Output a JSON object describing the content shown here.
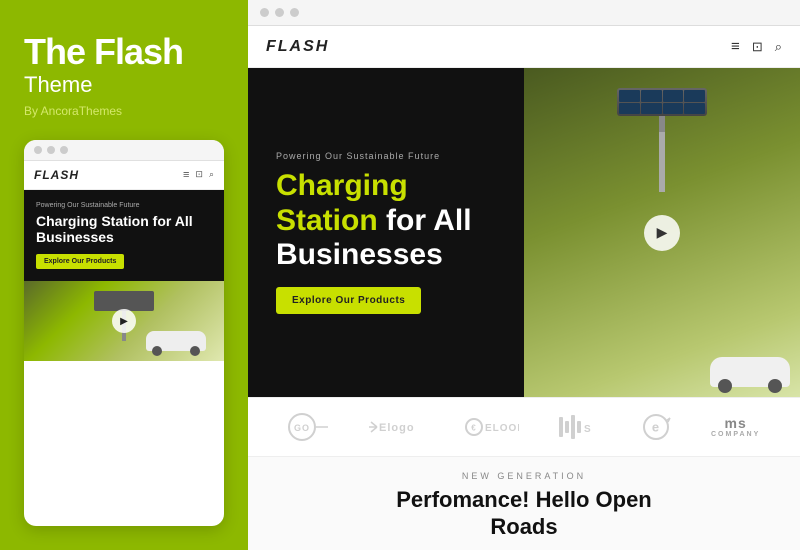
{
  "sidebar": {
    "title": "The Flash",
    "subtitle": "Theme",
    "byline": "By AncoraThemes",
    "mobile_dots": [
      "dot1",
      "dot2",
      "dot3"
    ],
    "mobile_logo": "FLASH",
    "mobile_eyebrow": "Powering Our Sustainable Future",
    "mobile_hero_title_yellow": "Charging Station",
    "mobile_hero_title_white": "for All Businesses",
    "mobile_cta": "Explore Our Products"
  },
  "browser": {
    "dots": [
      "dot1",
      "dot2",
      "dot3"
    ]
  },
  "navbar": {
    "logo": "FLASH",
    "menu_icon": "≡",
    "bag_icon": "🛍",
    "search_icon": "🔍"
  },
  "hero": {
    "eyebrow": "Powering Our Sustainable Future",
    "title_yellow": "Charging Station",
    "title_white": " for All Businesses",
    "cta_label": "Explore Our Products",
    "play_icon": "▶"
  },
  "logos": [
    {
      "id": "go-logo",
      "text": "GO",
      "type": "circle-text"
    },
    {
      "id": "elogo",
      "text": "Elogo",
      "type": "text-with-lines"
    },
    {
      "id": "eloop",
      "text": "ELOOP",
      "type": "text-with-e"
    },
    {
      "id": "bars-logo",
      "text": "||||S",
      "type": "bars"
    },
    {
      "id": "e-logo",
      "text": "e",
      "type": "circle-e"
    },
    {
      "id": "company-logo",
      "line1": "ms",
      "line2": "COMPANY",
      "type": "company"
    }
  ],
  "bottom": {
    "eyebrow": "NEW GENERATION",
    "title_line1": "Perfomance! Hello Open",
    "title_line2": "Roads"
  }
}
